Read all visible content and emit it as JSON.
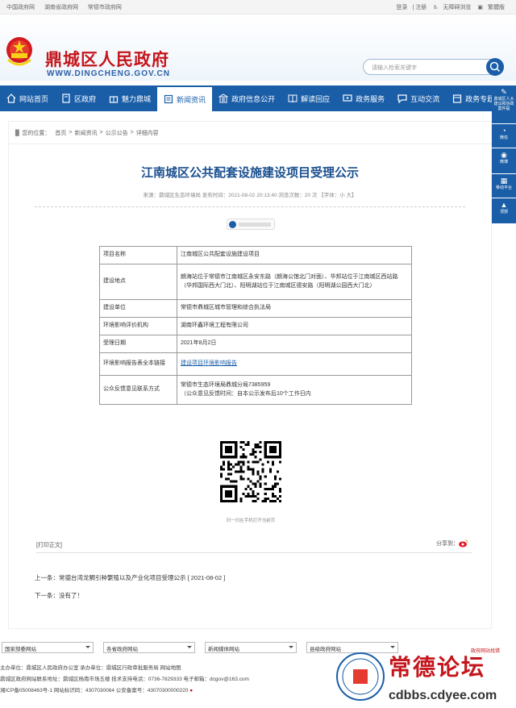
{
  "topbar": {
    "left": [
      "中国政府网",
      "湖南省政府网",
      "常德市政府网"
    ],
    "right": [
      "登录",
      "注册",
      "无障碍浏览",
      "繁體版"
    ]
  },
  "header": {
    "title": "鼎城区人民政府",
    "url": "WWW.DINGCHENG.GOV.CN",
    "search_placeholder": "请输入检索关键字"
  },
  "nav": [
    {
      "label": "网站首页",
      "icon": "home-icon"
    },
    {
      "label": "区政府",
      "icon": "building-icon"
    },
    {
      "label": "魅力鼎城",
      "icon": "gift-icon"
    },
    {
      "label": "新闻资讯",
      "icon": "news-icon",
      "active": true
    },
    {
      "label": "政府信息公开",
      "icon": "bank-icon"
    },
    {
      "label": "解读回应",
      "icon": "book-icon"
    },
    {
      "label": "政务服务",
      "icon": "monitor-icon"
    },
    {
      "label": "互动交流",
      "icon": "chat-icon"
    },
    {
      "label": "政务专题",
      "icon": "calendar-icon"
    }
  ],
  "sidebar": [
    "鼎城区人大建议和协政案件提",
    "微信",
    "微博",
    "移动平台",
    "顶部"
  ],
  "breadcrumb": {
    "prefix": "您的位置：",
    "items": [
      "首页",
      "新闻资讯",
      "公示公告",
      "详细内容"
    ]
  },
  "article": {
    "title": "江南城区公共配套设施建设项目受理公示",
    "meta": "来源：鼎城区生态环境局    发布时间：2021-08-02 20:13:40    浏览次数：20 次    【字体：小 大】"
  },
  "table": [
    {
      "k": "项目名称",
      "v": "江南城区公共配套设施建设项目"
    },
    {
      "k": "建设地点",
      "v": "朗海站位于常德市江南城区永安东路（朗海公馆北门对面）、华邦站位于江南城区西站路（华邦国际西大门北）、阳明湖站位于江南城区德安路（阳明湖公园西大门北）"
    },
    {
      "k": "建设单位",
      "v": "常德市鼎城区城市管理和综合执法局"
    },
    {
      "k": "环境影响评价机构",
      "v": "湖南环鑫环境工程有限公司"
    },
    {
      "k": "受理日期",
      "v": "2021年8月2日"
    },
    {
      "k": "环境影响报告表全本链接",
      "v": "建设项目环境影响报告",
      "link": true
    },
    {
      "k": "公众反馈意见联系方式",
      "v": "常德市生态环境局鼎城分局7385959",
      "v2": "（公众意见反馈时间：自本公示发布后10个工作日内"
    }
  ],
  "qr_caption": "扫一扫在手机打开当前页",
  "print_label": "[打印正文]",
  "share_label": "分享到：",
  "prev": "上一条：常德台湾龙鲷引种繁殖以及产业化项目受理公示 [ 2021-08-02 ]",
  "next": "下一条：没有了！",
  "link_selects": [
    "国家部委网站",
    "各省政府网站",
    "新闻媒体网站",
    "县级政府网站"
  ],
  "footer": [
    "主办单位：鼎城区人民政府办公室   承办单位：鼎城区行政审批服务局   网站地图",
    "鼎城区政府网站联系地址：鼎城区杨南市场五楼   技术支持电话：0736-7829333   电子邮箱：dcgov@163.com",
    "湘ICP备05008463号-1   网站标识码：4307030064      公安备案号：43070300000220"
  ],
  "watermark": {
    "text": "常德论坛",
    "url": "cdbbs.cdyee.com",
    "badge": "政府网站找错"
  },
  "colors": {
    "primary": "#1a5ea8",
    "title_red": "#c4161c"
  }
}
